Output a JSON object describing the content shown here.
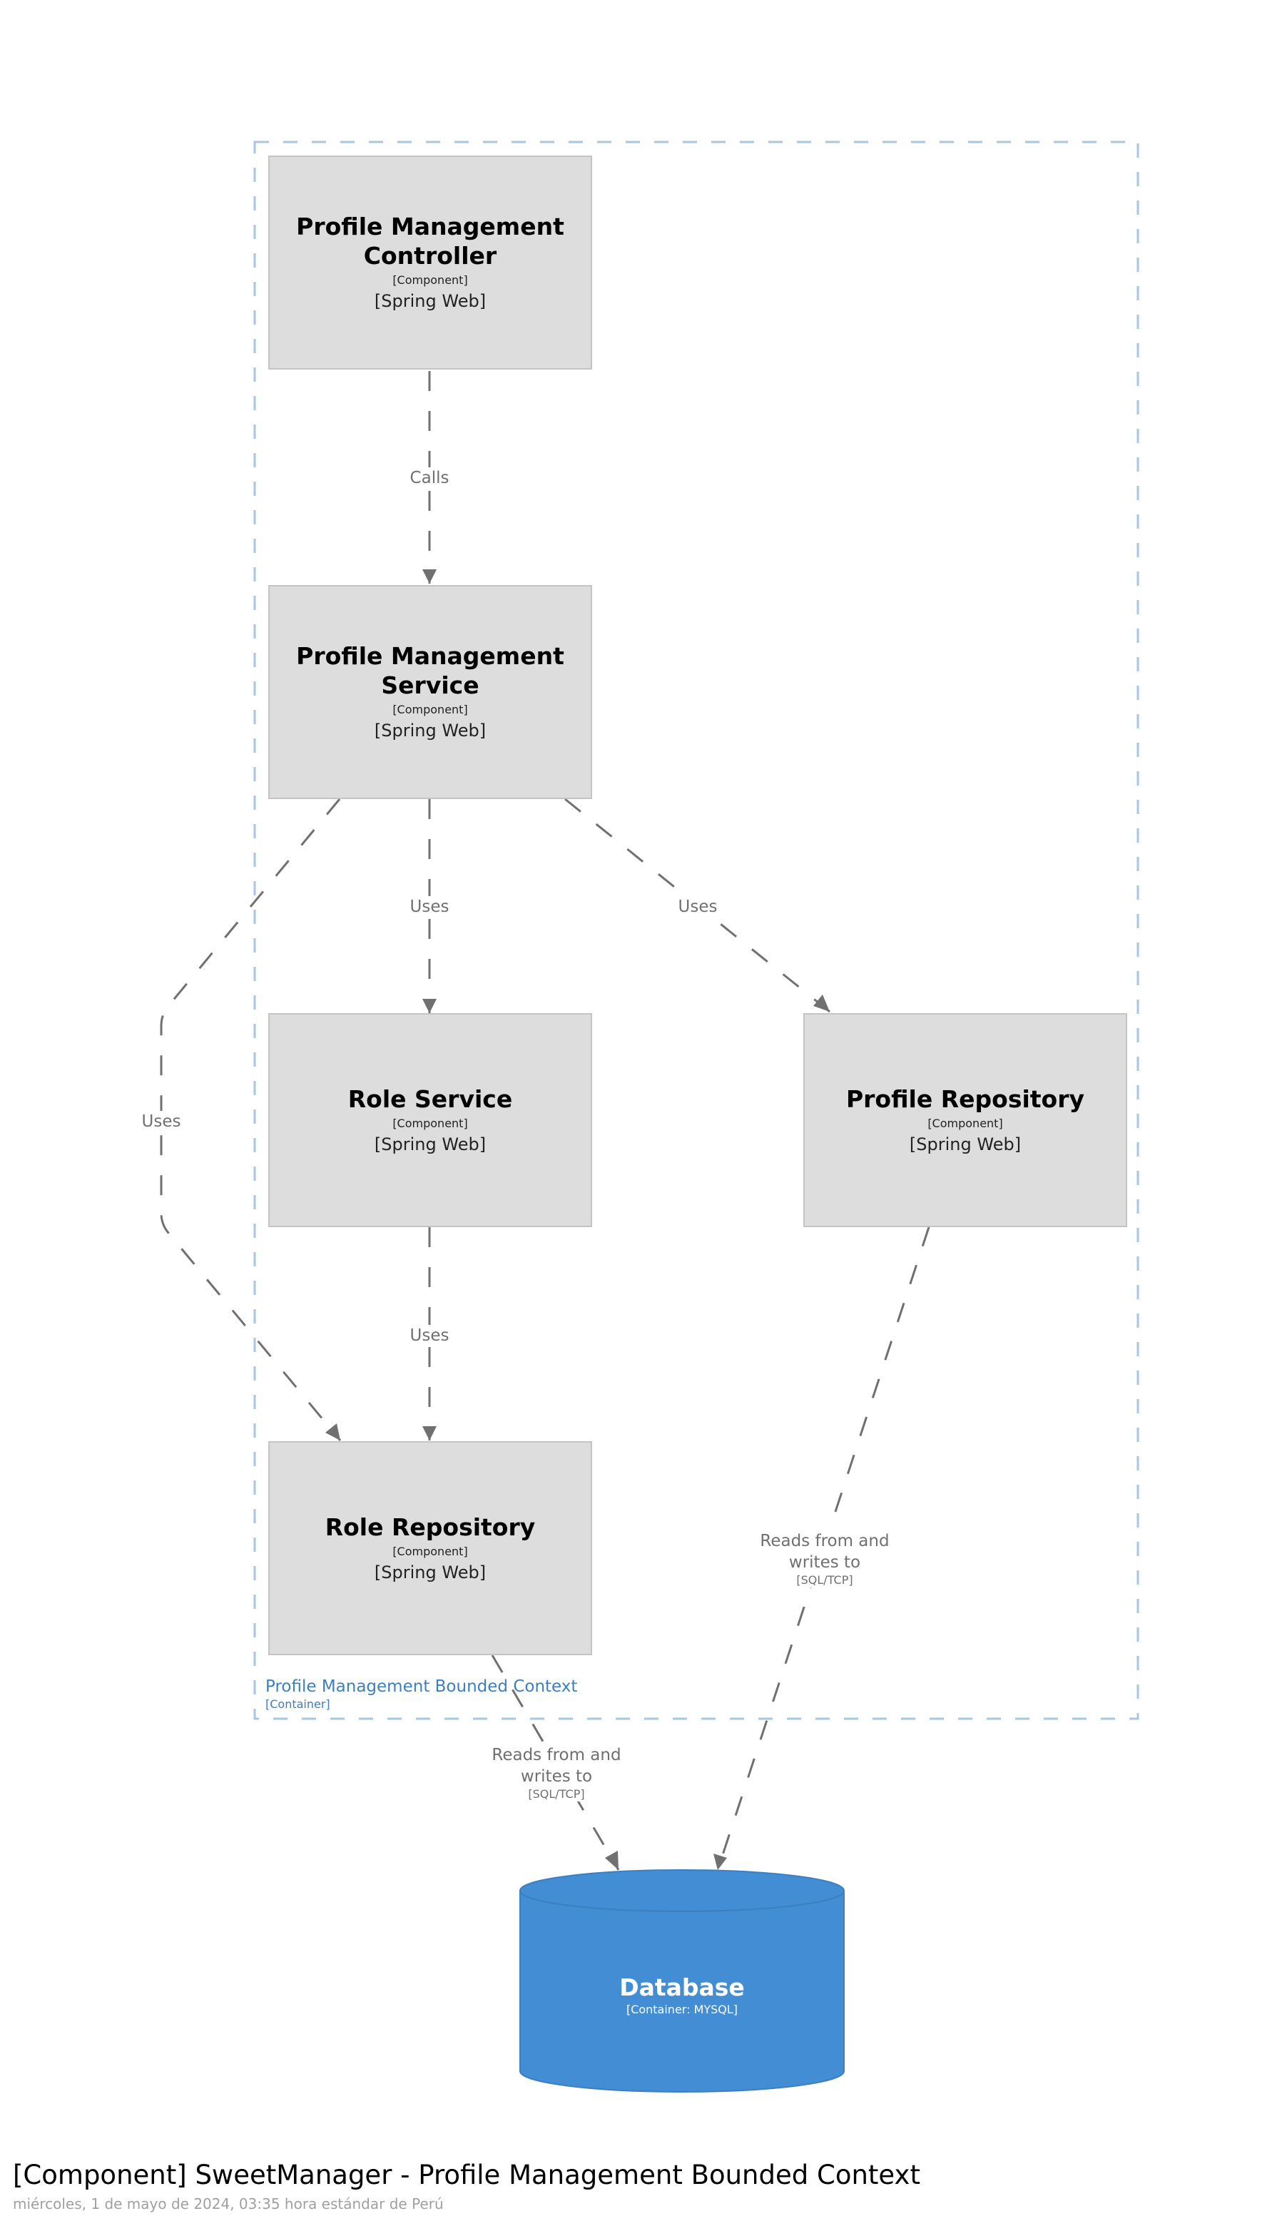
{
  "colors": {
    "component_fill": "#dddddd",
    "component_border": "#c4c4c4",
    "boundary_stroke": "#a8c6e2",
    "boundary_label": "#3d7fbf",
    "edge": "#707070",
    "database_fill": "#438dd5",
    "database_stroke": "#3c7fc0"
  },
  "boundary": {
    "name": "Profile Management Bounded Context",
    "type": "[Container]"
  },
  "components": [
    {
      "id": "controller",
      "name": "Profile Management Controller",
      "type": "[Component]",
      "technology": "[Spring Web]"
    },
    {
      "id": "service",
      "name": "Profile Management Service",
      "type": "[Component]",
      "technology": "[Spring Web]"
    },
    {
      "id": "role_service",
      "name": "Role Service",
      "type": "[Component]",
      "technology": "[Spring Web]"
    },
    {
      "id": "profile_repository",
      "name": "Profile Repository",
      "type": "[Component]",
      "technology": "[Spring Web]"
    },
    {
      "id": "role_repository",
      "name": "Role Repository",
      "type": "[Component]",
      "technology": "[Spring Web]"
    }
  ],
  "database": {
    "name": "Database",
    "type": "[Container: MYSQL]"
  },
  "relationships": [
    {
      "from": "controller",
      "to": "service",
      "label": "Calls",
      "technology": ""
    },
    {
      "from": "service",
      "to": "role_service",
      "label": "Uses",
      "technology": ""
    },
    {
      "from": "service",
      "to": "profile_repository",
      "label": "Uses",
      "technology": ""
    },
    {
      "from": "service",
      "to": "role_repository",
      "label": "Uses",
      "technology": ""
    },
    {
      "from": "role_service",
      "to": "role_repository",
      "label": "Uses",
      "technology": ""
    },
    {
      "from": "role_repository",
      "to": "database",
      "label": "Reads from and writes to",
      "technology": "[SQL/TCP]"
    },
    {
      "from": "profile_repository",
      "to": "database",
      "label": "Reads from and writes to",
      "technology": "[SQL/TCP]"
    }
  ],
  "footer": {
    "title": "[Component] SweetManager - Profile Management Bounded Context",
    "subtitle": "miércoles, 1 de mayo de 2024, 03:35 hora estándar de Perú"
  }
}
